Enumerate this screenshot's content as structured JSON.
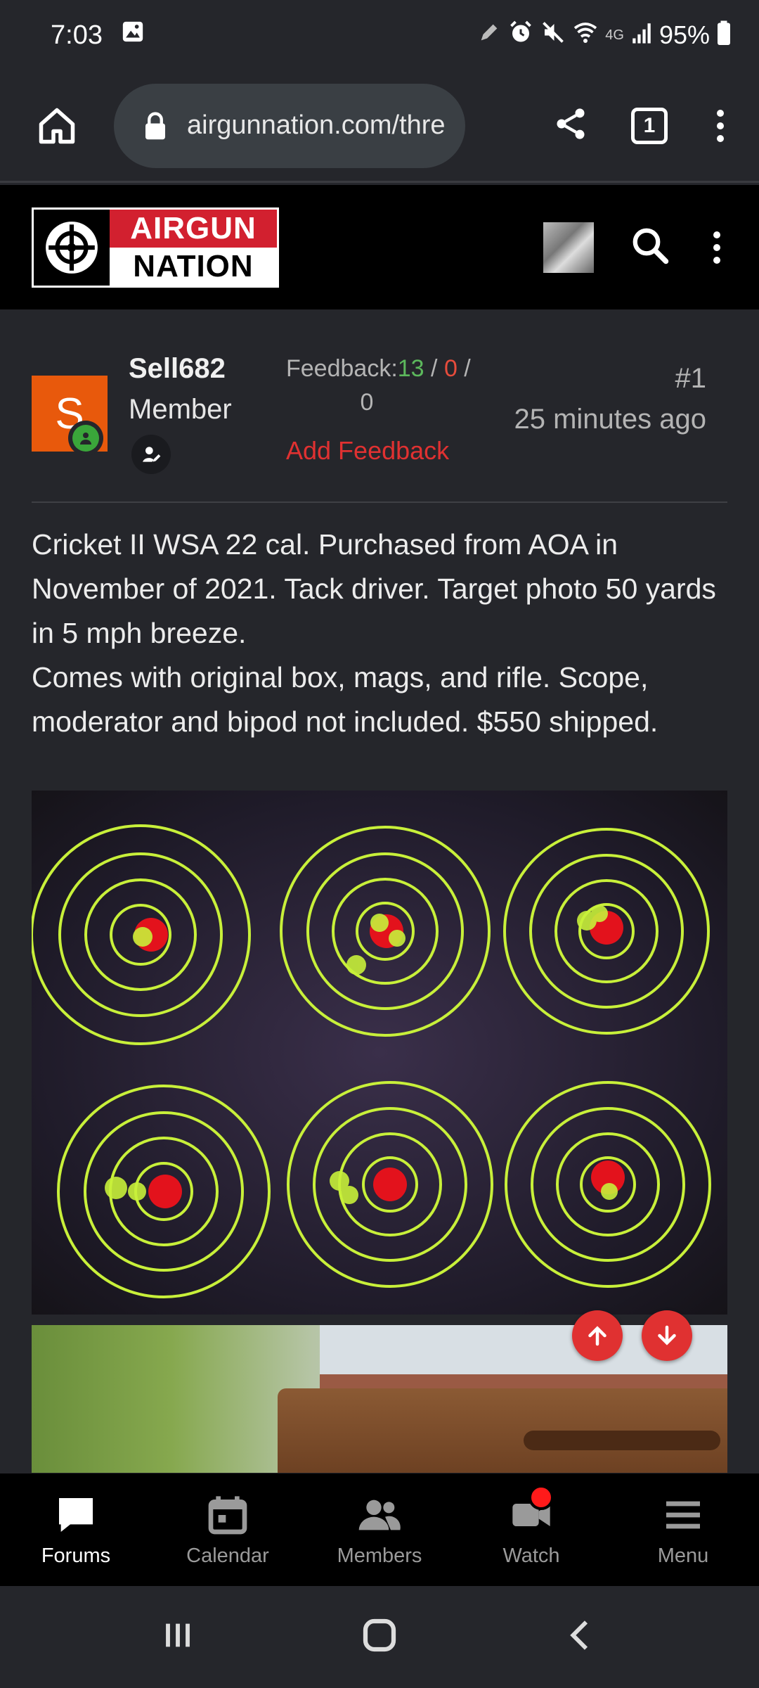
{
  "status_bar": {
    "time": "7:03",
    "network": "4G",
    "battery": "95%",
    "icons": [
      "image-icon",
      "pen-icon",
      "alarm-icon",
      "mute-icon",
      "wifi-icon",
      "signal-icon",
      "battery-icon"
    ]
  },
  "browser": {
    "url": "airgunnation.com/thre",
    "tab_count": "1"
  },
  "site": {
    "logo_line1": "AIRGUN",
    "logo_line2": "NATION"
  },
  "post": {
    "username": "Sell682",
    "user_title": "Member",
    "avatar_letter": "S",
    "feedback_label": "Feedback:",
    "feedback_positive": "13",
    "feedback_sep1": " / ",
    "feedback_negative": "0",
    "feedback_sep2": " /",
    "feedback_neutral": "0",
    "add_feedback": "Add Feedback",
    "post_number": "#1",
    "post_time": "25 minutes ago",
    "body_line1": "Cricket II WSA 22 cal. Purchased from AOA in November of 2021. Tack driver. Target photo 50 yards in 5 mph breeze.",
    "body_line2": "Comes with original box, mags, and rifle. Scope, moderator and bipod not included. $550 shipped."
  },
  "bottom_nav": {
    "items": [
      {
        "label": "Forums",
        "icon": "chat-icon",
        "active": true
      },
      {
        "label": "Calendar",
        "icon": "calendar-icon",
        "active": false
      },
      {
        "label": "Members",
        "icon": "members-icon",
        "active": false
      },
      {
        "label": "Watch",
        "icon": "video-icon",
        "active": false
      },
      {
        "label": "Menu",
        "icon": "hamburger-icon",
        "active": false
      }
    ]
  },
  "colors": {
    "accent_red": "#e03131",
    "positive_green": "#5cb85c",
    "background": "#25262b",
    "avatar_orange": "#e8590c"
  }
}
